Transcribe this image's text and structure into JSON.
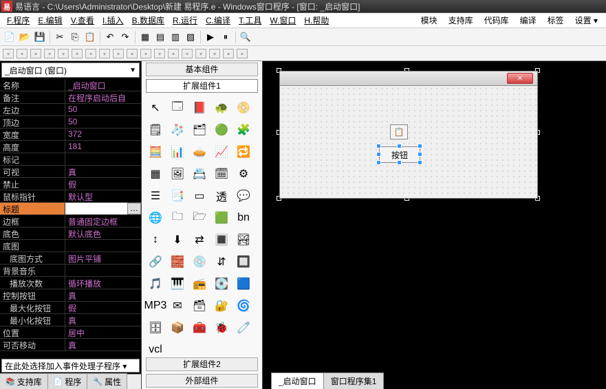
{
  "title": "易语言 - C:\\Users\\Administrator\\Desktop\\新建 易程序.e - Windows窗口程序 - [窗口: _启动窗口]",
  "menu": [
    "F.程序",
    "E.编辑",
    "V.查看",
    "I.插入",
    "B.数据库",
    "R.运行",
    "C.编译",
    "T.工具",
    "W.窗口",
    "H.帮助"
  ],
  "rmenu": [
    "模块",
    "支持库",
    "代码库",
    "编译",
    "标签",
    "设置 ▾"
  ],
  "dropdown": "_启动窗口 (窗口)",
  "props": [
    {
      "n": "名称",
      "v": "_启动窗口"
    },
    {
      "n": "备注",
      "v": "在程序启动后自"
    },
    {
      "n": "左边",
      "v": "50"
    },
    {
      "n": "顶边",
      "v": "50"
    },
    {
      "n": "宽度",
      "v": "372"
    },
    {
      "n": "高度",
      "v": "181"
    },
    {
      "n": "标记",
      "v": ""
    },
    {
      "n": "可视",
      "v": "真"
    },
    {
      "n": "禁止",
      "v": "假"
    },
    {
      "n": "鼠标指针",
      "v": "默认型"
    },
    {
      "n": "标题",
      "v": "",
      "sel": true,
      "e": true
    },
    {
      "n": "边框",
      "v": "普通固定边框"
    },
    {
      "n": "底色",
      "v": "默认底色"
    },
    {
      "n": "底图",
      "v": ""
    },
    {
      "n": "底图方式",
      "v": "图片平铺",
      "i": 1
    },
    {
      "n": "背景音乐",
      "v": ""
    },
    {
      "n": "播放次数",
      "v": "循环播放",
      "i": 1
    },
    {
      "n": "控制按钮",
      "v": "真"
    },
    {
      "n": "最大化按钮",
      "v": "假",
      "i": 1
    },
    {
      "n": "最小化按钮",
      "v": "真",
      "i": 1
    },
    {
      "n": "位置",
      "v": "居中"
    },
    {
      "n": "可否移动",
      "v": "真"
    }
  ],
  "eventdrop": "在此处选择加入事件处理子程序 ▾",
  "btabs": [
    {
      "l": "支持库",
      "i": "📚"
    },
    {
      "l": "程序",
      "i": "📄"
    },
    {
      "l": "属性",
      "i": "🔧"
    }
  ],
  "comptabs": [
    "基本组件",
    "扩展组件1"
  ],
  "comptabs2": [
    "扩展组件2",
    "外部组件"
  ],
  "designbutton": "按钮",
  "doctabs": [
    "_启动窗口",
    "窗口程序集1"
  ]
}
